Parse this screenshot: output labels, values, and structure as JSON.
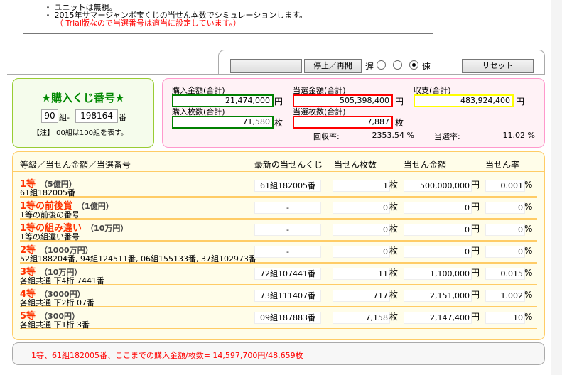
{
  "notes": [
    "・ ユニットは無視。",
    "・ 2015年サマージャンボ宝くじの当せん本数でシミュレーションします。",
    "（ Trial版なので当選番号は適当に設定しています。）"
  ],
  "controls": {
    "blank_button": "",
    "pause_button": "停止／再開",
    "slow_label": "遅",
    "fast_label": "速",
    "speed_selected": 3,
    "reset_button": "リセット"
  },
  "ticket": {
    "title": "★購入くじ番号★",
    "group": "90",
    "group_unit": "組-",
    "number": "198164",
    "number_unit": "番",
    "note": "【注】 00組は100組を表す。"
  },
  "summary": {
    "purchase_amount_label": "購入金額(合計)",
    "purchase_amount": "21,474,000",
    "yen": "円",
    "win_amount_label": "当選金額(合計)",
    "win_amount": "505,398,400",
    "balance_label": "収支(合計)",
    "balance": "483,924,400",
    "purchase_count_label": "購入枚数(合計)",
    "purchase_count": "71,580",
    "mai": "枚",
    "win_count_label": "当選枚数(合計)",
    "win_count": "7,887",
    "recovery_label": "回収率:",
    "recovery": "2353.54 %",
    "win_rate_label": "当選率:",
    "win_rate": "11.02 %",
    "colors": {
      "purchase": "#008000",
      "win": "#ff0000",
      "balance": "#ffff00"
    }
  },
  "table": {
    "headers": [
      "等級／当せん金額／当選番号",
      "最新の当せんくじ",
      "当せん枚数",
      "当せん金額",
      "当せん率"
    ],
    "rows": [
      {
        "name": "1等",
        "prize": "（5億円）",
        "desc": "61組182005番",
        "latest": "61組182005番",
        "count": "1",
        "amount": "500,000,000",
        "rate": "0.001"
      },
      {
        "name": "1等の前後賞",
        "prize": "（1億円）",
        "desc": "1等の前後の番号",
        "latest": "-",
        "count": "0",
        "amount": "0",
        "rate": "0"
      },
      {
        "name": "1等の組み違い",
        "prize": "（10万円）",
        "desc": "1等の組違い番号",
        "latest": "-",
        "count": "0",
        "amount": "0",
        "rate": "0"
      },
      {
        "name": "2等",
        "prize": "（1000万円）",
        "desc": "52組188204番, 94組124511番, 06組155133番, 37組102973番",
        "latest": "-",
        "count": "0",
        "amount": "0",
        "rate": "0"
      },
      {
        "name": "3等",
        "prize": "（10万円）",
        "desc": "各組共通 下4桁 7441番",
        "latest": "72組107441番",
        "count": "11",
        "amount": "1,100,000",
        "rate": "0.015"
      },
      {
        "name": "4等",
        "prize": "（3000円）",
        "desc": "各組共通 下2桁 07番",
        "latest": "73組111407番",
        "count": "717",
        "amount": "2,151,000",
        "rate": "1.002"
      },
      {
        "name": "5等",
        "prize": "（300円）",
        "desc": "各組共通 下1桁 3番",
        "latest": "09組187883番",
        "count": "7,158",
        "amount": "2,147,400",
        "rate": "10"
      }
    ],
    "count_unit": "枚",
    "amount_unit": "円",
    "rate_unit": "%"
  },
  "footer": "1等、61組182005番、ここまでの購入金額/枚数= 14,597,700円/48,659枚"
}
